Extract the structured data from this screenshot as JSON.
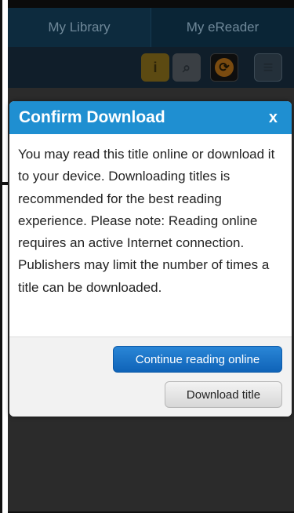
{
  "app": {
    "tabs": [
      {
        "label": "My Library"
      },
      {
        "label": "My eReader"
      }
    ],
    "toolbar_icons": [
      {
        "name": "info-icon",
        "glyph": "i"
      },
      {
        "name": "search-icon",
        "glyph": "⌕"
      },
      {
        "name": "sync-icon",
        "glyph": "⟳"
      },
      {
        "name": "menu-icon",
        "glyph": "≡"
      }
    ]
  },
  "modal": {
    "title": "Confirm Download",
    "close_glyph": "x",
    "message": "You may read this title online or download it to your device. Downloading titles is recommended for the best reading experience. Please note: Reading online requires an active Internet connection. Publishers may limit the number of times a title can be downloaded.",
    "primary_button": "Continue reading online",
    "secondary_button": "Download title"
  },
  "colors": {
    "header_blue": "#1f8fd1",
    "primary_button": "#1570c6",
    "overlay": "#2b2b2b"
  }
}
